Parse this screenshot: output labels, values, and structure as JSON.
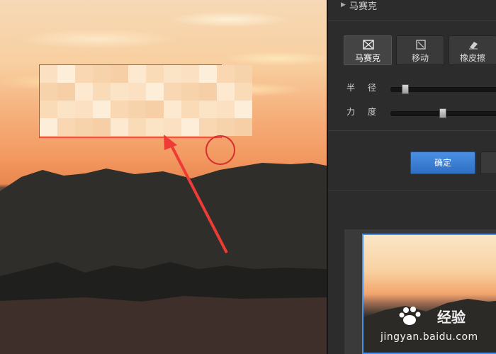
{
  "panel": {
    "header_title": "马赛克",
    "tools": [
      {
        "label": "马赛克",
        "icon": "mosaic-icon",
        "active": true
      },
      {
        "label": "移动",
        "icon": "move-icon",
        "active": false
      },
      {
        "label": "橡皮擦",
        "icon": "eraser-icon",
        "active": false
      }
    ],
    "sliders": [
      {
        "label": "半径",
        "value": 0.1
      },
      {
        "label": "力度",
        "value": 0.45
      }
    ],
    "ok_button": "确定"
  },
  "watermark": {
    "brand": "经验",
    "url": "jingyan.baidu.com",
    "logo": "Bai"
  },
  "colors": {
    "accent": "#3f82d6",
    "selection": "#e53935",
    "panel_bg": "#2c2c2c"
  }
}
